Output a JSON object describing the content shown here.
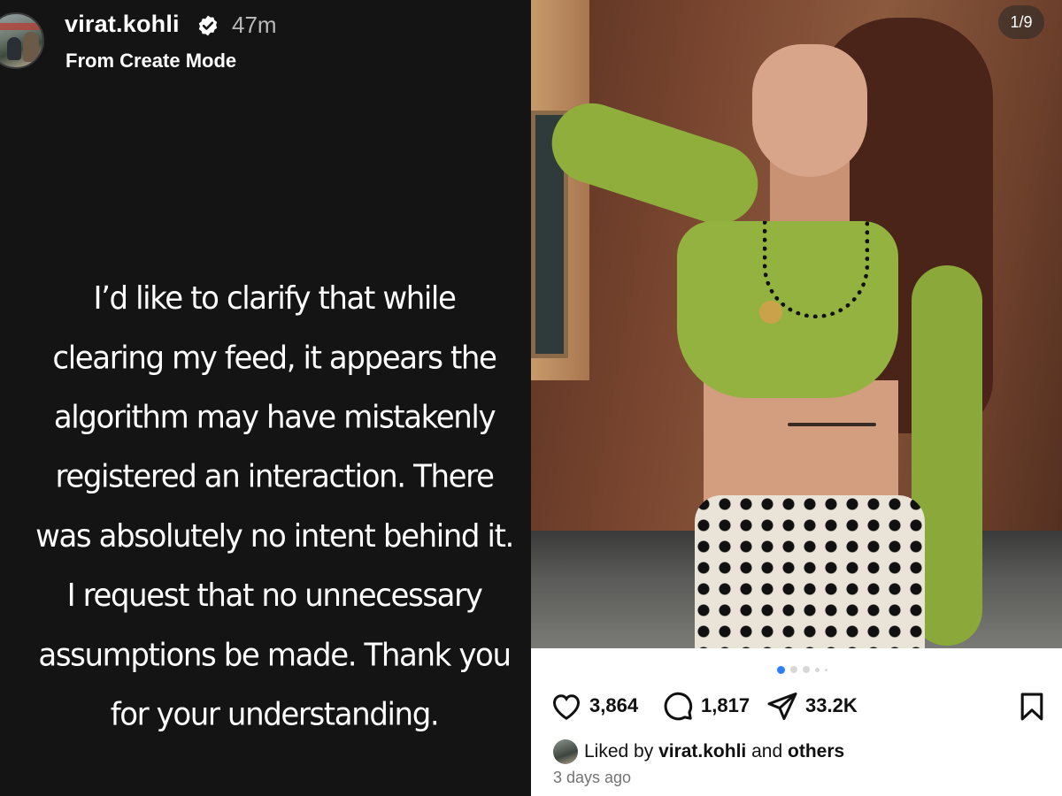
{
  "story": {
    "username": "virat.kohli",
    "time_ago": "47m",
    "subtitle": "From Create Mode",
    "lines": [
      "I’d like to clarify that while",
      "clearing my feed, it appears the",
      "algorithm may have mistakenly",
      "registered an interaction. There",
      "was absolutely no intent behind it.",
      "I request that no unnecessary",
      "assumptions be made. Thank you",
      "for your understanding."
    ]
  },
  "post": {
    "image_counter": "1/9",
    "likes_count": "3,864",
    "comments_count": "1,817",
    "shares_count": "33.2K",
    "liked_by_prefix": "Liked by",
    "liked_by_user": "virat.kohli",
    "liked_by_join": "and",
    "liked_by_others": "others",
    "posted_ago": "3 days ago"
  },
  "colors": {
    "story_bg": "#141414",
    "dot_active": "#2f7df6",
    "muted_text": "#737373"
  },
  "icons": [
    "verified-badge-icon",
    "heart-icon",
    "comment-icon",
    "share-icon",
    "bookmark-icon"
  ]
}
